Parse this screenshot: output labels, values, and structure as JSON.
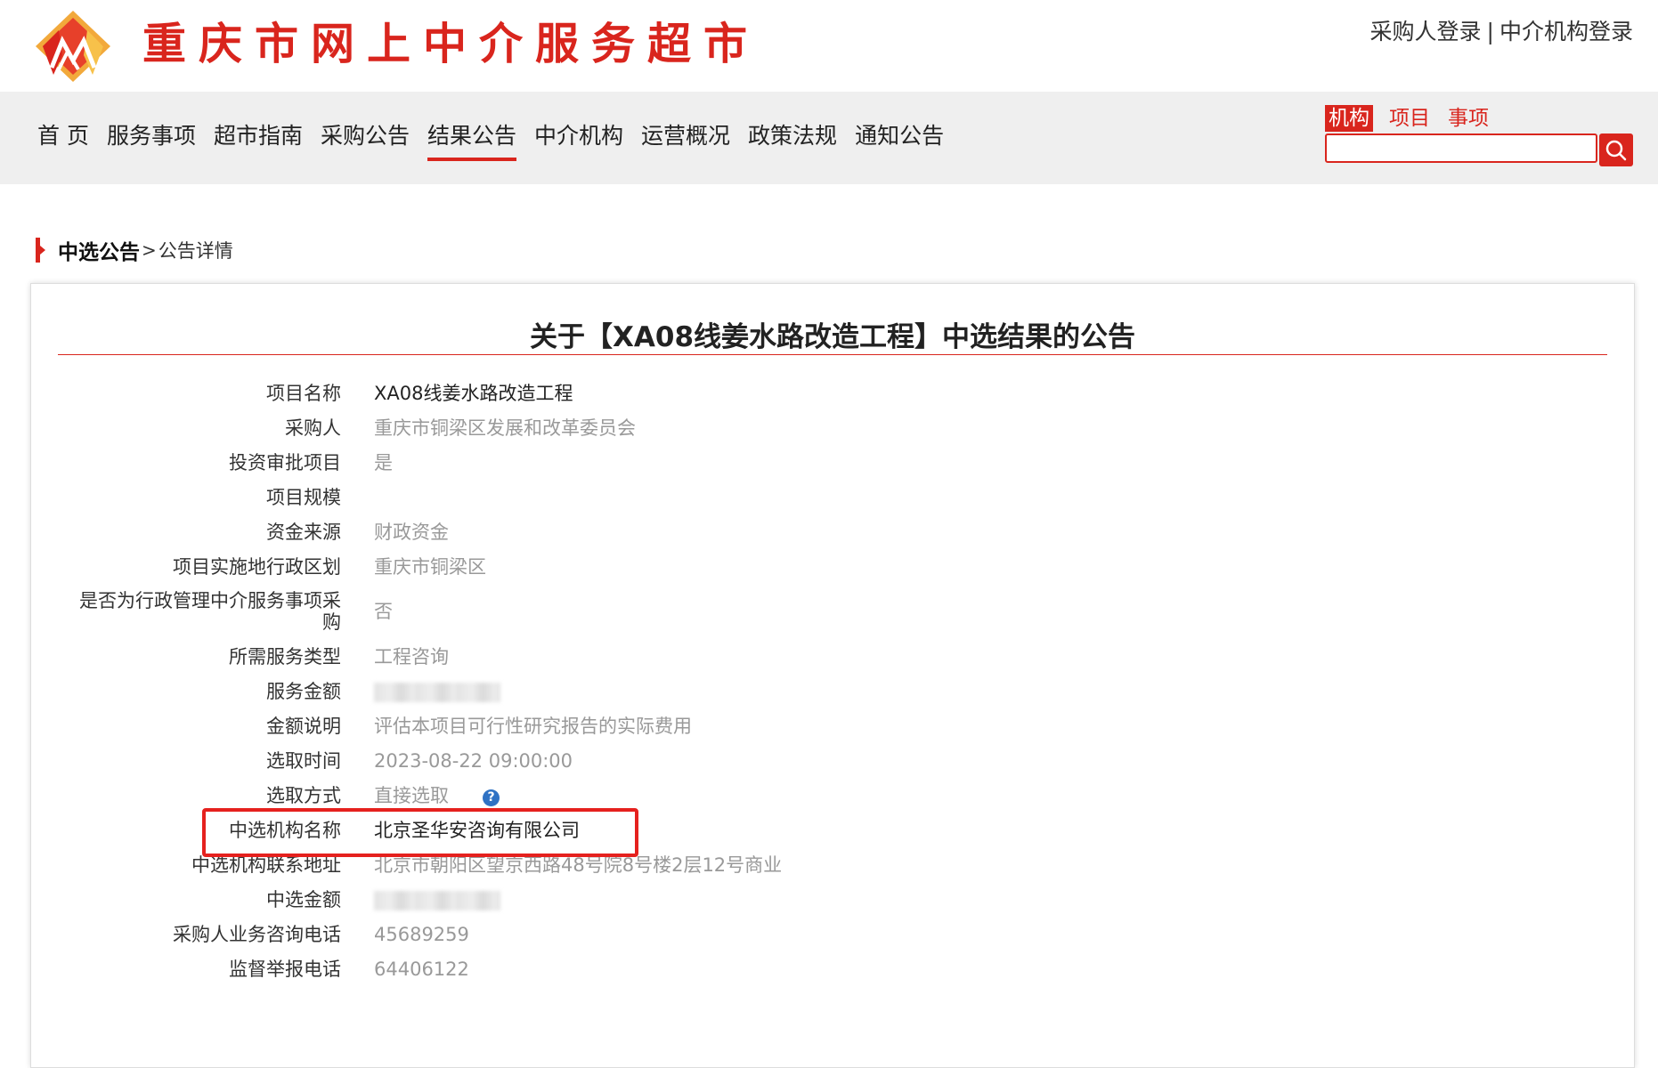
{
  "header": {
    "site_title": "重庆市网上中介服务超市",
    "login_links": [
      "采购人登录",
      "中介机构登录"
    ],
    "login_separator": "|"
  },
  "nav": {
    "items": [
      {
        "label": "首 页"
      },
      {
        "label": "服务事项"
      },
      {
        "label": "超市指南"
      },
      {
        "label": "采购公告"
      },
      {
        "label": "结果公告",
        "active": true
      },
      {
        "label": "中介机构"
      },
      {
        "label": "运营概况"
      },
      {
        "label": "政策法规"
      },
      {
        "label": "通知公告"
      }
    ]
  },
  "search": {
    "tabs": [
      {
        "label": "机构",
        "active": true
      },
      {
        "label": "项目"
      },
      {
        "label": "事项"
      }
    ],
    "value": "",
    "button_icon": "search-icon"
  },
  "breadcrumb": {
    "section": "中选公告",
    "separator": ">",
    "page": "公告详情"
  },
  "notice": {
    "title": "关于【XA08线姜水路改造工程】中选结果的公告",
    "fields": [
      {
        "label": "项目名称",
        "value": "XA08线姜水路改造工程",
        "style": "dark"
      },
      {
        "label": "采购人",
        "value": "重庆市铜梁区发展和改革委员会"
      },
      {
        "label": "投资审批项目",
        "value": "是"
      },
      {
        "label": "项目规模",
        "value": ""
      },
      {
        "label": "资金来源",
        "value": "财政资金"
      },
      {
        "label": "项目实施地行政区划",
        "value": "重庆市铜梁区"
      },
      {
        "label": "是否为行政管理中介服务事项采购",
        "value": "否",
        "tall": true
      },
      {
        "label": "所需服务类型",
        "value": "工程咨询"
      },
      {
        "label": "服务金额",
        "value": "",
        "redacted": true
      },
      {
        "label": "金额说明",
        "value": "评估本项目可行性研究报告的实际费用"
      },
      {
        "label": "选取时间",
        "value": "2023-08-22 09:00:00"
      },
      {
        "label": "选取方式",
        "value": "直接选取",
        "help_icon": "question-circle-icon"
      },
      {
        "label": "中选机构名称",
        "value": "北京圣华安咨询有限公司",
        "style": "dark",
        "highlighted": true
      },
      {
        "label": "中选机构联系地址",
        "value": "北京市朝阳区望京西路48号院8号楼2层12号商业"
      },
      {
        "label": "中选金额",
        "value": "",
        "redacted": true
      },
      {
        "label": "采购人业务咨询电话",
        "value": "45689259"
      },
      {
        "label": "监督举报电话",
        "value": "64406122"
      }
    ]
  },
  "colors": {
    "brand_red": "#d9251d",
    "highlight_red": "#e5211e",
    "nav_bg": "#efefef",
    "value_gray": "#999999",
    "help_blue": "#2f72c4"
  }
}
